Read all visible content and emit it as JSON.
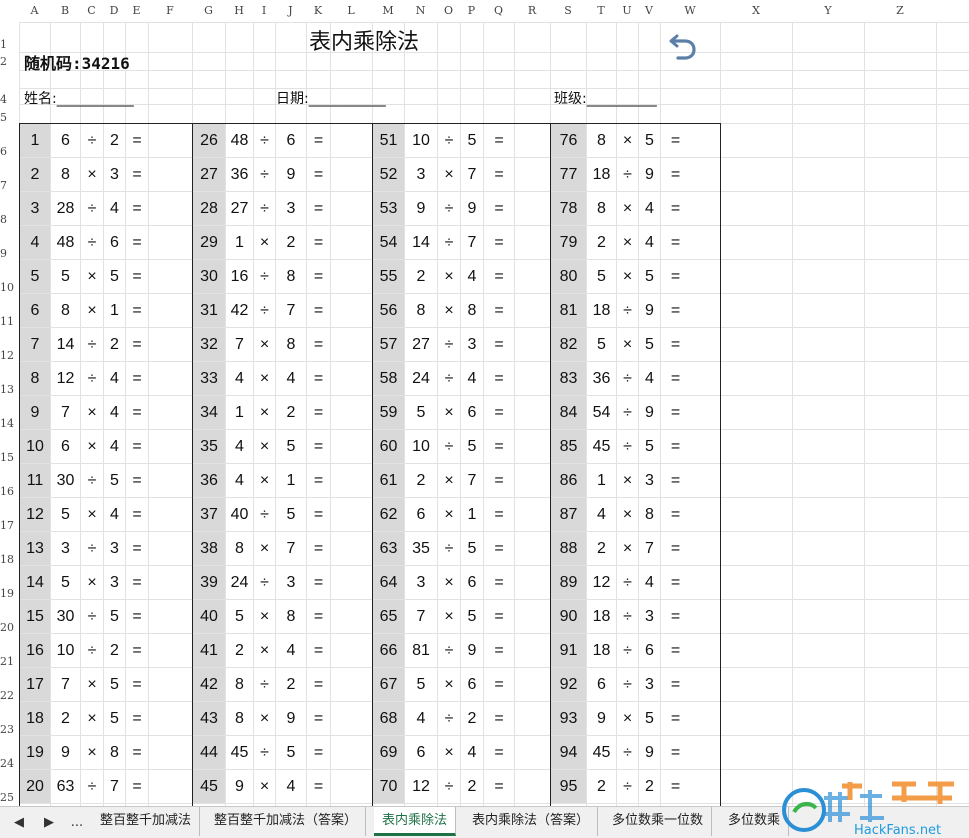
{
  "sheet": {
    "columns": [
      "A",
      "B",
      "C",
      "D",
      "E",
      "F",
      "G",
      "H",
      "I",
      "J",
      "K",
      "L",
      "M",
      "N",
      "O",
      "P",
      "Q",
      "R",
      "S",
      "T",
      "U",
      "V",
      "W",
      "X",
      "Y",
      "Z"
    ],
    "rows": [
      "1",
      "2",
      "4",
      "5",
      "6",
      "7",
      "8",
      "9",
      "10",
      "11",
      "12",
      "13",
      "14",
      "15",
      "16",
      "17",
      "18",
      "19",
      "20",
      "21",
      "22",
      "23",
      "24",
      "25"
    ],
    "title": "表内乘除法",
    "random_code": "随机码:34216",
    "name_field": "姓名:___________",
    "date_field": "日期:___________",
    "class_field": "班级:__________",
    "undo_icon": "undo-arrow-icon",
    "equals": "=",
    "problems": [
      [
        [
          "1",
          "6",
          "÷",
          "2"
        ],
        [
          "2",
          "8",
          "×",
          "3"
        ],
        [
          "3",
          "28",
          "÷",
          "4"
        ],
        [
          "4",
          "48",
          "÷",
          "6"
        ],
        [
          "5",
          "5",
          "×",
          "5"
        ],
        [
          "6",
          "8",
          "×",
          "1"
        ],
        [
          "7",
          "14",
          "÷",
          "2"
        ],
        [
          "8",
          "12",
          "÷",
          "4"
        ],
        [
          "9",
          "7",
          "×",
          "4"
        ],
        [
          "10",
          "6",
          "×",
          "4"
        ],
        [
          "11",
          "30",
          "÷",
          "5"
        ],
        [
          "12",
          "5",
          "×",
          "4"
        ],
        [
          "13",
          "3",
          "÷",
          "3"
        ],
        [
          "14",
          "5",
          "×",
          "3"
        ],
        [
          "15",
          "30",
          "÷",
          "5"
        ],
        [
          "16",
          "10",
          "÷",
          "2"
        ],
        [
          "17",
          "7",
          "×",
          "5"
        ],
        [
          "18",
          "2",
          "×",
          "5"
        ],
        [
          "19",
          "9",
          "×",
          "8"
        ],
        [
          "20",
          "63",
          "÷",
          "7"
        ]
      ],
      [
        [
          "26",
          "48",
          "÷",
          "6"
        ],
        [
          "27",
          "36",
          "÷",
          "9"
        ],
        [
          "28",
          "27",
          "÷",
          "3"
        ],
        [
          "29",
          "1",
          "×",
          "2"
        ],
        [
          "30",
          "16",
          "÷",
          "8"
        ],
        [
          "31",
          "42",
          "÷",
          "7"
        ],
        [
          "32",
          "7",
          "×",
          "8"
        ],
        [
          "33",
          "4",
          "×",
          "4"
        ],
        [
          "34",
          "1",
          "×",
          "2"
        ],
        [
          "35",
          "4",
          "×",
          "5"
        ],
        [
          "36",
          "4",
          "×",
          "1"
        ],
        [
          "37",
          "40",
          "÷",
          "5"
        ],
        [
          "38",
          "8",
          "×",
          "7"
        ],
        [
          "39",
          "24",
          "÷",
          "3"
        ],
        [
          "40",
          "5",
          "×",
          "8"
        ],
        [
          "41",
          "2",
          "×",
          "4"
        ],
        [
          "42",
          "8",
          "÷",
          "2"
        ],
        [
          "43",
          "8",
          "×",
          "9"
        ],
        [
          "44",
          "45",
          "÷",
          "5"
        ],
        [
          "45",
          "9",
          "×",
          "4"
        ]
      ],
      [
        [
          "51",
          "10",
          "÷",
          "5"
        ],
        [
          "52",
          "3",
          "×",
          "7"
        ],
        [
          "53",
          "9",
          "÷",
          "9"
        ],
        [
          "54",
          "14",
          "÷",
          "7"
        ],
        [
          "55",
          "2",
          "×",
          "4"
        ],
        [
          "56",
          "8",
          "×",
          "8"
        ],
        [
          "57",
          "27",
          "÷",
          "3"
        ],
        [
          "58",
          "24",
          "÷",
          "4"
        ],
        [
          "59",
          "5",
          "×",
          "6"
        ],
        [
          "60",
          "10",
          "÷",
          "5"
        ],
        [
          "61",
          "2",
          "×",
          "7"
        ],
        [
          "62",
          "6",
          "×",
          "1"
        ],
        [
          "63",
          "35",
          "÷",
          "5"
        ],
        [
          "64",
          "3",
          "×",
          "6"
        ],
        [
          "65",
          "7",
          "×",
          "5"
        ],
        [
          "66",
          "81",
          "÷",
          "9"
        ],
        [
          "67",
          "5",
          "×",
          "6"
        ],
        [
          "68",
          "4",
          "÷",
          "2"
        ],
        [
          "69",
          "6",
          "×",
          "4"
        ],
        [
          "70",
          "12",
          "÷",
          "2"
        ]
      ],
      [
        [
          "76",
          "8",
          "×",
          "5"
        ],
        [
          "77",
          "18",
          "÷",
          "9"
        ],
        [
          "78",
          "8",
          "×",
          "4"
        ],
        [
          "79",
          "2",
          "×",
          "4"
        ],
        [
          "80",
          "5",
          "×",
          "5"
        ],
        [
          "81",
          "18",
          "÷",
          "9"
        ],
        [
          "82",
          "5",
          "×",
          "5"
        ],
        [
          "83",
          "36",
          "÷",
          "4"
        ],
        [
          "84",
          "54",
          "÷",
          "9"
        ],
        [
          "85",
          "45",
          "÷",
          "5"
        ],
        [
          "86",
          "1",
          "×",
          "3"
        ],
        [
          "87",
          "4",
          "×",
          "8"
        ],
        [
          "88",
          "2",
          "×",
          "7"
        ],
        [
          "89",
          "12",
          "÷",
          "4"
        ],
        [
          "90",
          "18",
          "÷",
          "3"
        ],
        [
          "91",
          "18",
          "÷",
          "6"
        ],
        [
          "92",
          "6",
          "÷",
          "3"
        ],
        [
          "93",
          "9",
          "×",
          "5"
        ],
        [
          "94",
          "45",
          "÷",
          "9"
        ],
        [
          "95",
          "2",
          "÷",
          "2"
        ]
      ]
    ]
  },
  "tabbar": {
    "nav_prev": "◀",
    "nav_next": "▶",
    "nav_more": "...",
    "tabs": [
      "整百整千加减法",
      "整百整千加减法（答案）",
      "表内乘除法",
      "表内乘除法（答案）",
      "多位数乘一位数",
      "多位数乘"
    ],
    "active_index": 2
  },
  "watermark": {
    "text": "HackFans.net"
  }
}
